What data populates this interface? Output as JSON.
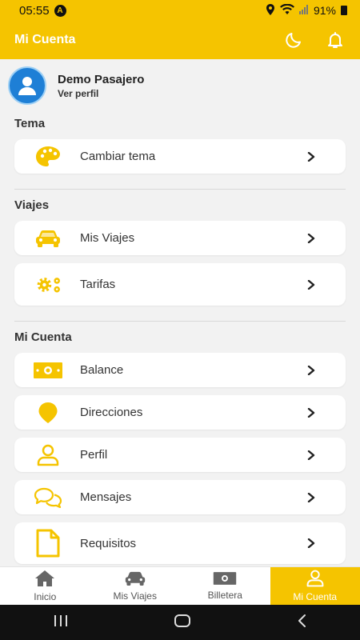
{
  "status_bar": {
    "time": "05:55",
    "badge": "A",
    "battery": "91%"
  },
  "header": {
    "title": "Mi Cuenta",
    "icons": [
      "moon-icon",
      "bell-icon"
    ]
  },
  "profile": {
    "name": "Demo Pasajero",
    "link": "Ver perfil"
  },
  "sections": {
    "tema": {
      "title": "Tema",
      "items": [
        {
          "label": "Cambiar tema",
          "icon": "palette-icon"
        }
      ]
    },
    "viajes": {
      "title": "Viajes",
      "items": [
        {
          "label": "Mis Viajes",
          "icon": "car-icon"
        },
        {
          "label": "Tarifas",
          "icon": "gears-icon"
        }
      ]
    },
    "cuenta": {
      "title": "Mi Cuenta",
      "items": [
        {
          "label": "Balance",
          "icon": "cash-icon"
        },
        {
          "label": "Direcciones",
          "icon": "map-pin-icon"
        },
        {
          "label": "Perfil",
          "icon": "user-icon"
        },
        {
          "label": "Mensajes",
          "icon": "chat-icon"
        },
        {
          "label": "Requisitos",
          "icon": "document-icon"
        }
      ]
    }
  },
  "bottom_nav": [
    {
      "label": "Inicio",
      "icon": "home-icon"
    },
    {
      "label": "Mis Viajes",
      "icon": "car-icon"
    },
    {
      "label": "Billetera",
      "icon": "cash-icon"
    },
    {
      "label": "Mi Cuenta",
      "icon": "user-icon",
      "active": true
    }
  ],
  "colors": {
    "accent": "#f5c400",
    "avatar": "#1e7fd6"
  }
}
